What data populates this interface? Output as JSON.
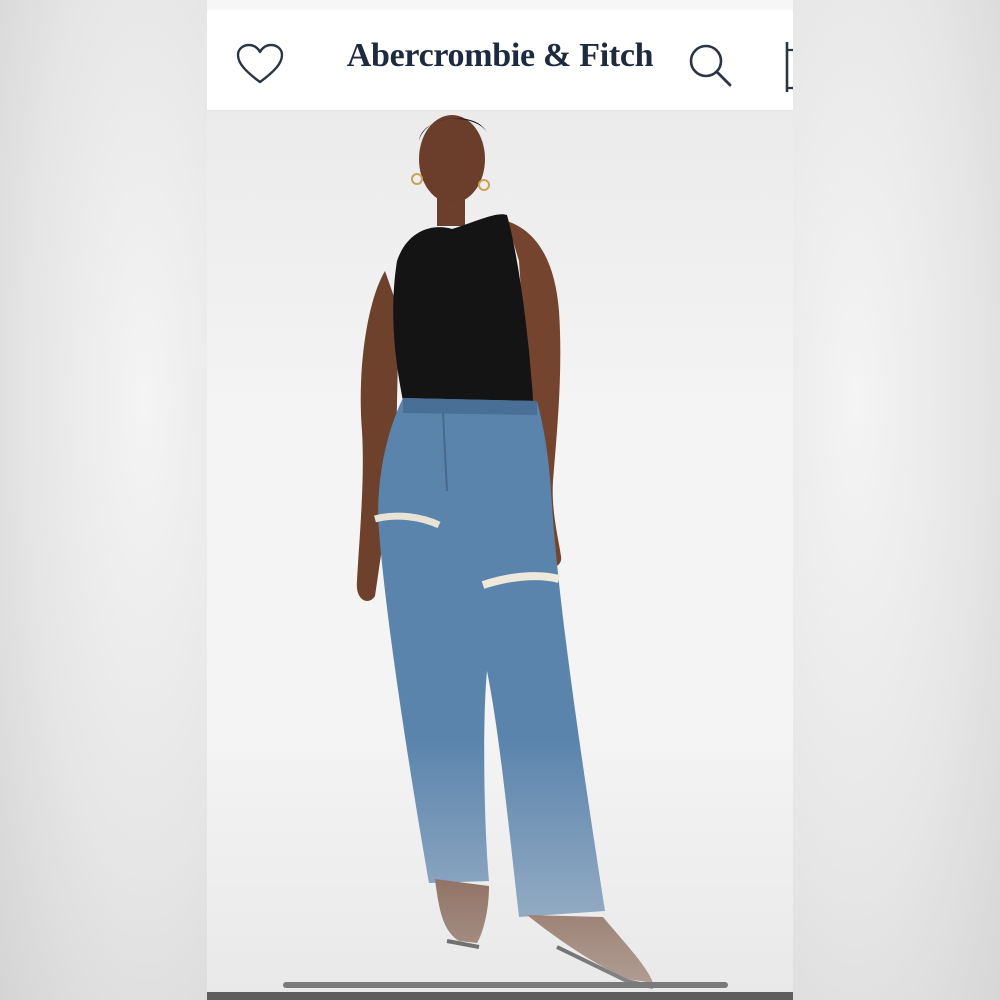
{
  "header": {
    "brand": "Abercrombie & Fitch",
    "wishlist_icon": "heart-icon",
    "search_icon": "search-icon",
    "bag_icon": "bag-icon"
  },
  "product_photo": {
    "subject": "model wearing black sleeveless bodysuit and light-wash ripped straight-leg jeans with black thong sandals",
    "colors": {
      "top": "#141414",
      "denim": "#5b84ad",
      "skin": "#7a4a33",
      "background": "#f2f2f2"
    }
  },
  "colors": {
    "brand": "#1d2a3f",
    "header_bg": "#ffffff"
  }
}
